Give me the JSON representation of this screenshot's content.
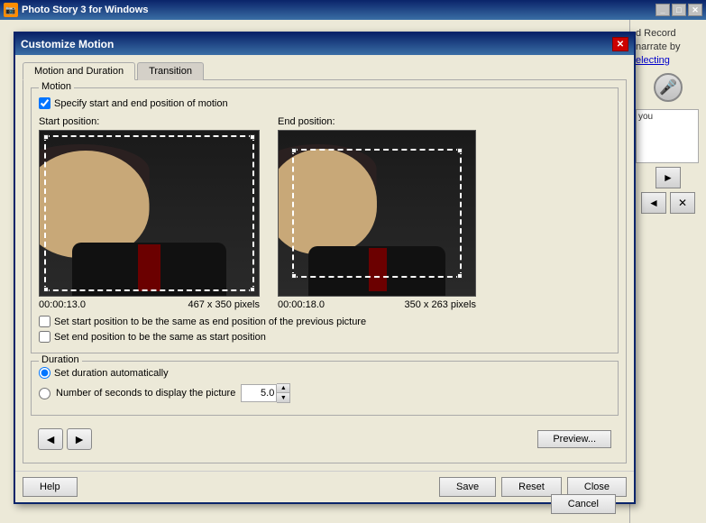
{
  "window": {
    "title": "Photo Story 3 for Windows",
    "icon": "📷"
  },
  "dialog": {
    "title": "Customize Motion",
    "tabs": [
      {
        "id": "motion",
        "label": "Motion and Duration",
        "active": true
      },
      {
        "id": "transition",
        "label": "Transition",
        "active": false
      }
    ],
    "motion_group": {
      "label": "Motion",
      "specify_checkbox": {
        "label": "Specify start and end position of motion",
        "checked": true
      },
      "start_position": {
        "label": "Start position:",
        "time": "00:00:13.0",
        "pixels": "467 x 350 pixels"
      },
      "end_position": {
        "label": "End position:",
        "time": "00:00:18.0",
        "pixels": "350 x 263 pixels"
      },
      "same_as_prev_checkbox": {
        "label": "Set start position to be the same as end position of the previous picture",
        "checked": false
      },
      "same_as_start_checkbox": {
        "label": "Set end position to be the same as start position",
        "checked": false
      }
    },
    "duration_group": {
      "label": "Duration",
      "auto_radio": {
        "label": "Set duration automatically",
        "checked": true
      },
      "seconds_radio": {
        "label": "Number of seconds to display the picture",
        "checked": false
      },
      "seconds_value": "5.0"
    },
    "footer": {
      "preview_btn": "Preview...",
      "help_btn": "Help",
      "save_btn": "Save",
      "reset_btn": "Reset",
      "close_btn": "Close"
    }
  },
  "right_panel": {
    "text1": "d Record",
    "text2": "narrate by",
    "link": "electing",
    "you_text": "you",
    "nav_up": "▲",
    "nav_right": "►",
    "nav_left": "◄",
    "nav_x": "✕"
  },
  "bottom_bar": {
    "cancel_btn": "Cancel"
  }
}
